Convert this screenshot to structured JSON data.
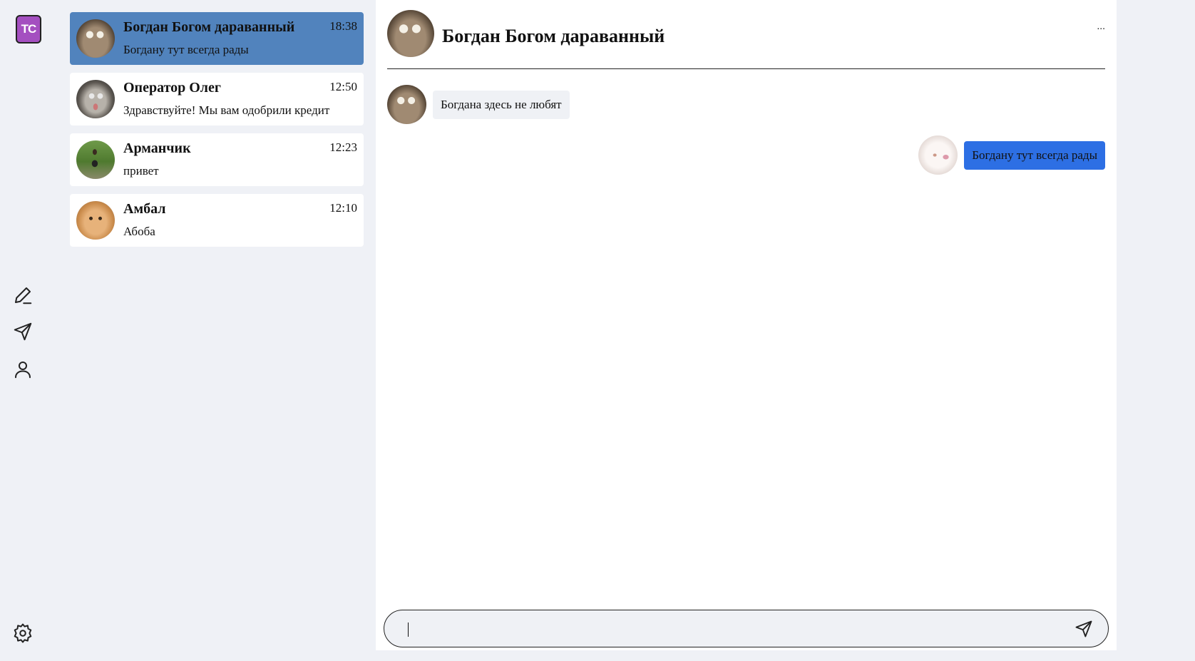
{
  "app": {
    "logo_text": "TC"
  },
  "rail": {
    "icons": [
      "pencil-icon",
      "send-icon",
      "user-icon",
      "gear-icon"
    ]
  },
  "chats": [
    {
      "name": "Богдан Богом дараванный",
      "time": "18:38",
      "preview": "Богдану тут всегда рады",
      "active": true
    },
    {
      "name": "Оператор Олег",
      "time": "12:50",
      "preview": "Здравствуйте! Мы вам одобрили кредит",
      "active": false
    },
    {
      "name": "Арманчик",
      "time": "12:23",
      "preview": "привет",
      "active": false
    },
    {
      "name": "Амбал",
      "time": "12:10",
      "preview": "Абоба",
      "active": false
    }
  ],
  "conversation": {
    "title": "Богдан Богом дараванный",
    "more_label": "...",
    "messages": [
      {
        "direction": "incoming",
        "text": "Богдана здесь не любят"
      },
      {
        "direction": "outgoing",
        "text": "Богдану тут всегда рады"
      }
    ]
  },
  "composer": {
    "value": "",
    "placeholder": ""
  },
  "colors": {
    "background": "#eff1f6",
    "active_chat": "#5183bd",
    "outgoing_bubble": "#2d6fe4",
    "incoming_bubble": "#eff1f5",
    "logo": "#a44fc0"
  }
}
